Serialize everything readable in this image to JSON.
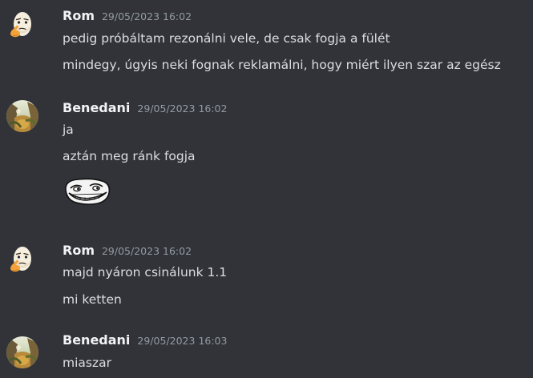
{
  "messages": [
    {
      "author": "Rom",
      "timestamp": "29/05/2023 16:02",
      "avatar": "thinking-egg-icon",
      "lines": [
        "pedig próbáltam rezonálni vele, de csak fogja a fülét",
        "mindegy, úgyis neki fognak reklamálni, hogy miért ilyen szar az egész"
      ]
    },
    {
      "author": "Benedani",
      "timestamp": "29/05/2023 16:02",
      "avatar": "landscape-photo-avatar",
      "lines": [
        "ja",
        "aztán meg ránk fogja"
      ],
      "attachment": "troll-face-sticker"
    },
    {
      "author": "Rom",
      "timestamp": "29/05/2023 16:02",
      "avatar": "thinking-egg-icon",
      "lines": [
        "majd nyáron csinálunk 1.1",
        "mi ketten"
      ]
    },
    {
      "author": "Benedani",
      "timestamp": "29/05/2023 16:03",
      "avatar": "landscape-photo-avatar",
      "lines": [
        "miaszar"
      ]
    }
  ],
  "colors": {
    "background": "#313338",
    "username": "#f2f3f5",
    "timestamp": "#949ba4",
    "message_text": "#dbdee1"
  }
}
